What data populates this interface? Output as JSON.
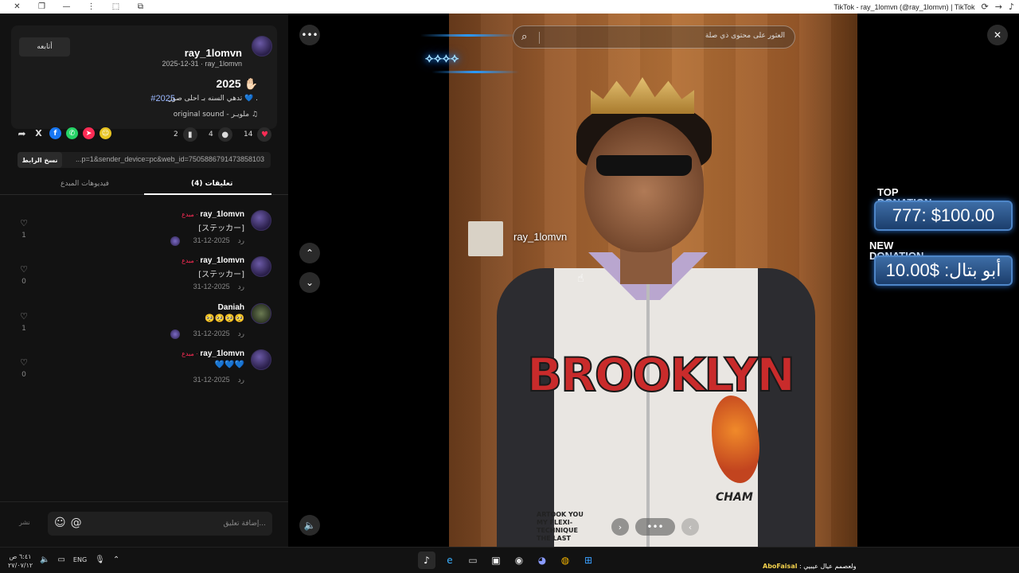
{
  "titlebar": {
    "title": "TikTok - ray_1lomvn (@ray_1lomvn) | TikTok",
    "left_icons": [
      "close-icon",
      "restore-icon",
      "minimize-icon",
      "more-icon",
      "extensions-icon",
      "pin-icon"
    ],
    "right_icons": [
      "refresh-icon",
      "forward-icon",
      "tiktok-icon"
    ]
  },
  "post": {
    "username": "ray_1lomvn",
    "subline": "2025-12-31 · ray_1lomvn",
    "follow_label": "أتابعه",
    "title": "2025 ✋🏻",
    "description": "تدهي السنه بـ احلى صور 💙 .",
    "hashtag": "#2025",
    "sound": "original sound - ملويـر",
    "likes": "14",
    "comments": "4",
    "saves": "2",
    "link": "...p=1&sender_device=pc&web_id=7505886791473858103",
    "copy_label": "نسخ الرابط"
  },
  "tabs": {
    "comments": "تعليقات (4)",
    "creator_videos": "فيديوهات المبدع"
  },
  "comments": [
    {
      "name": "ray_1lomvn",
      "badge": "مبدع ·",
      "text": "[ステッカー]",
      "date": "2025-12-31",
      "reply": "رد",
      "likes": "1"
    },
    {
      "name": "ray_1lomvn",
      "badge": "مبدع ·",
      "text": "[ステッカー]",
      "date": "2025-12-31",
      "reply": "رد",
      "likes": "0"
    },
    {
      "name": "Daniah",
      "badge": "",
      "text": "🥺🥺🥺🥺",
      "date": "2025-12-31",
      "reply": "رد",
      "likes": "1"
    },
    {
      "name": "ray_1lomvn",
      "badge": "مبدع ·",
      "text": "💙💙💙",
      "date": "2025-12-31",
      "reply": "رد",
      "likes": "0"
    }
  ],
  "comment_input": {
    "placeholder": "إضافة تعليق...",
    "post_label": "نشر"
  },
  "video": {
    "search_placeholder": "العثور على محتوى ذي صلة",
    "overlay_username": "ray_1lomvn",
    "jacket_text": "BROOKLYN",
    "jacket_small": "ARTOOK YOU\nMY FLEXI-\nTECHNIQUE\nTHE LAST",
    "jacket_brand": "CHAM"
  },
  "donations": {
    "top_label": "TOP\nDONATION",
    "top_value": "777: $100.00",
    "new_label": "NEW\nDONATION",
    "new_value": "أبو بتال: $10.00"
  },
  "taskbar": {
    "time": "٦:٤١ ص",
    "date": "٢٧/٠٧/١٢",
    "lang": "ENG",
    "ticker_name": "AboFaisal",
    "ticker_text": ": ولعصمم عيال عيبيي",
    "apps": [
      "tiktok-app",
      "edge-app",
      "terminal-app",
      "store-app",
      "obs-app",
      "discord-app",
      "chrome-app",
      "windows-app"
    ]
  },
  "colors": {
    "accent": "#fe2c55",
    "panel": "#121212",
    "donation_border": "#4e86c8"
  }
}
